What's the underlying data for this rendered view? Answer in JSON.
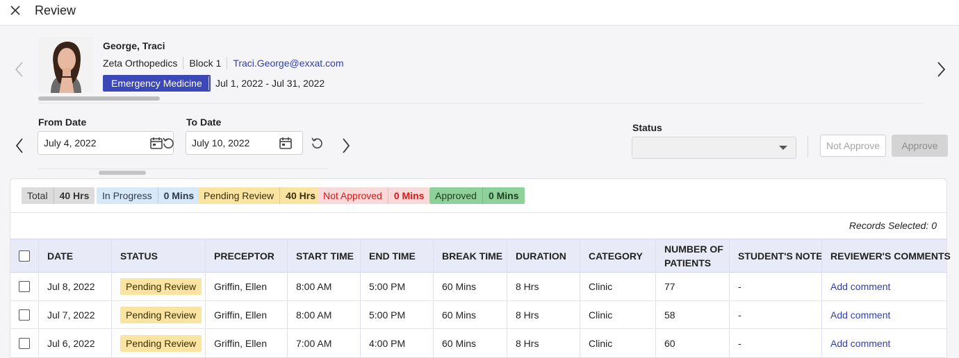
{
  "header": {
    "title": "Review"
  },
  "student": {
    "name": "George, Traci",
    "site": "Zeta Orthopedics",
    "block": "Block 1",
    "email": "Traci.George@exxat.com",
    "specialty": "Emergency Medicine",
    "rotation_dates": "Jul 1, 2022 - Jul 31, 2022"
  },
  "filters": {
    "from_label": "From Date",
    "from_value": "July 4, 2022",
    "to_label": "To Date",
    "to_value": "July 10, 2022",
    "status_label": "Status",
    "status_value": "",
    "not_approve_label": "Not Approve",
    "approve_label": "Approve"
  },
  "summary": {
    "total": {
      "label": "Total",
      "value": "40 Hrs"
    },
    "in_progress": {
      "label": "In Progress",
      "value": "0 Mins"
    },
    "pending": {
      "label": "Pending Review",
      "value": "40 Hrs"
    },
    "not_approved": {
      "label": "Not Approved",
      "value": "0 Mins"
    },
    "approved": {
      "label": "Approved",
      "value": "0 Mins"
    }
  },
  "records_selected": "Records Selected: 0",
  "table": {
    "headers": {
      "date": "DATE",
      "status": "STATUS",
      "preceptor": "PRECEPTOR",
      "start": "START TIME",
      "end": "END TIME",
      "break": "BREAK TIME",
      "duration": "DURATION",
      "category": "CATEGORY",
      "patients_1": "NUMBER OF",
      "patients_2": "PATIENTS",
      "student_note": "STUDENT'S NOTE",
      "reviewer": "REVIEWER'S COMMENTS"
    },
    "rows": [
      {
        "date": "Jul 8, 2022",
        "status": "Pending Review",
        "preceptor": "Griffin, Ellen",
        "start": "8:00 AM",
        "end": "5:00 PM",
        "break": "60 Mins",
        "duration": "8 Hrs",
        "category": "Clinic",
        "patients": "77",
        "note": "-",
        "comment": "Add comment"
      },
      {
        "date": "Jul 7, 2022",
        "status": "Pending Review",
        "preceptor": "Griffin, Ellen",
        "start": "8:00 AM",
        "end": "5:00 PM",
        "break": "60 Mins",
        "duration": "8 Hrs",
        "category": "Clinic",
        "patients": "58",
        "note": "-",
        "comment": "Add comment"
      },
      {
        "date": "Jul 6, 2022",
        "status": "Pending Review",
        "preceptor": "Griffin, Ellen",
        "start": "7:00 AM",
        "end": "4:00 PM",
        "break": "60 Mins",
        "duration": "8 Hrs",
        "category": "Clinic",
        "patients": "60",
        "note": "-",
        "comment": "Add comment"
      }
    ]
  }
}
